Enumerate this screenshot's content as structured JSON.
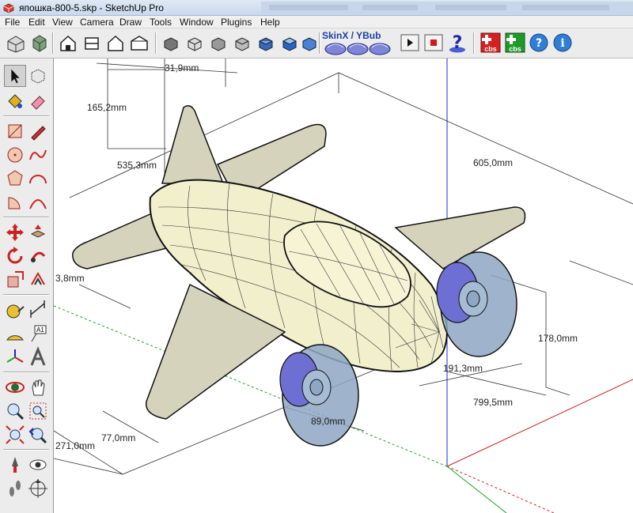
{
  "window": {
    "title": "япошка-800-5.skp - SketchUp Pro"
  },
  "menu": {
    "items": [
      "File",
      "Edit",
      "View",
      "Camera",
      "Draw",
      "Tools",
      "Window",
      "Plugins",
      "Help"
    ]
  },
  "toolbar": {
    "skin_label": "SkinX / YBub",
    "cbs_label": "cbs",
    "help_glyph": "?",
    "info_glyph": "i",
    "icons": [
      "get-models-icon",
      "share-model-icon",
      "iso-view-icon",
      "top-view-icon",
      "front-view-icon",
      "right-view-icon",
      "back-view-icon",
      "left-view-icon",
      "xray-icon",
      "wireframe-icon",
      "hidden-line-icon",
      "shaded-icon",
      "shaded-textures-icon",
      "monochrome-icon",
      "skin-tool-icon",
      "play-icon",
      "stop-icon",
      "help-icon",
      "cbs-remove-icon",
      "cbs-add-icon",
      "help-circle-icon",
      "info-icon"
    ]
  },
  "left_tools": {
    "icons": [
      "select-icon",
      "component-icon",
      "paint-bucket-icon",
      "eraser-icon",
      "rectangle-icon",
      "pencil-icon",
      "circle-icon",
      "freehand-icon",
      "polygon-icon",
      "arc-icon",
      "pie-icon",
      "three-point-arc-icon",
      "move-icon",
      "push-pull-icon",
      "rotate-icon",
      "follow-me-icon",
      "scale-icon",
      "offset-icon",
      "tape-measure-icon",
      "dimension-icon",
      "protractor-icon",
      "text-icon",
      "axes-icon",
      "3d-text-icon",
      "orbit-icon",
      "pan-icon",
      "zoom-icon",
      "zoom-window-icon",
      "zoom-extents-icon",
      "previous-view-icon",
      "position-camera-icon",
      "look-around-icon",
      "walk-icon",
      "section-plane-icon"
    ]
  },
  "model": {
    "dimensions": [
      {
        "label": "31,9mm"
      },
      {
        "label": "165,2mm"
      },
      {
        "label": "535,3mm"
      },
      {
        "label": "605,0mm"
      },
      {
        "label": "3,8mm"
      },
      {
        "label": "178,0mm"
      },
      {
        "label": "191,3mm"
      },
      {
        "label": "799,5mm"
      },
      {
        "label": "89,0mm"
      },
      {
        "label": "77,0mm"
      },
      {
        "label": "271,0mm"
      }
    ]
  },
  "colors": {
    "fuselage": "#f2efcd",
    "wing": "#d6d3bd",
    "wheel": "#8ea7c3",
    "hub": "#6e6fd2",
    "axis_blue": "#1a2bd6",
    "axis_green": "#20a020",
    "axis_red": "#cc2222"
  }
}
